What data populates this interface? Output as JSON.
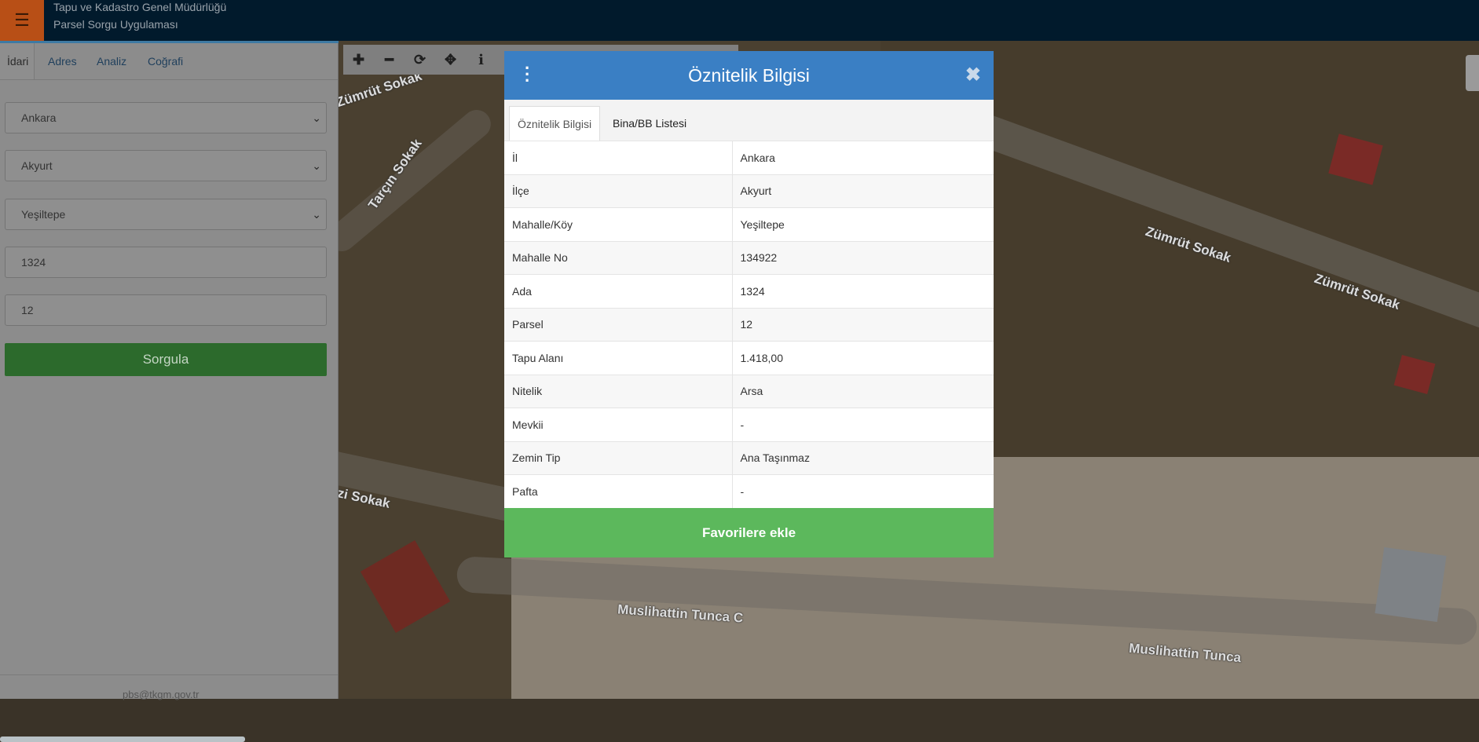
{
  "app": {
    "org_title": "Tapu ve Kadastro Genel Müdürlüğü",
    "app_title": "Parsel Sorgu Uygulaması",
    "menu_icon": "hamburger-icon"
  },
  "sidebar": {
    "tabs": [
      "İdari",
      "Adres",
      "Analiz",
      "Coğrafi"
    ],
    "active_tab": "İdari",
    "il": "Ankara",
    "ilce": "Akyurt",
    "mahalle": "Yeşiltepe",
    "ada": "1324",
    "parsel": "12",
    "query_button": "Sorgula",
    "footer_email": "pbs@tkgm.gov.tr"
  },
  "map": {
    "toolbar_icons": [
      "zoom-in-icon",
      "zoom-out-icon",
      "refresh-icon",
      "pan-icon",
      "info-icon"
    ],
    "road_labels": [
      "Zümrüt Sokak",
      "Tarçın Sokak",
      "Zümrüt Sokak",
      "Zümrüt Sokak",
      "zi Sokak",
      "Muslihattin Tunca C",
      "Muslihattin Tunca"
    ]
  },
  "modal": {
    "title": "Öznitelik Bilgisi",
    "tabs": [
      "Öznitelik Bilgisi",
      "Bina/BB Listesi"
    ],
    "rows": [
      {
        "key": "İl",
        "value": "Ankara"
      },
      {
        "key": "İlçe",
        "value": "Akyurt"
      },
      {
        "key": "Mahalle/Köy",
        "value": "Yeşiltepe"
      },
      {
        "key": "Mahalle No",
        "value": "134922"
      },
      {
        "key": "Ada",
        "value": "1324"
      },
      {
        "key": "Parsel",
        "value": "12"
      },
      {
        "key": "Tapu Alanı",
        "value": "1.418,00"
      },
      {
        "key": "Nitelik",
        "value": "Arsa"
      },
      {
        "key": "Mevkii",
        "value": "-"
      },
      {
        "key": "Zemin Tip",
        "value": "Ana Taşınmaz"
      },
      {
        "key": "Pafta",
        "value": "-"
      }
    ],
    "favorite_button": "Favorilere ekle"
  },
  "colors": {
    "header_blue": "#3a7fc4",
    "favorite_green": "#5cb85c",
    "query_green": "#2c6a2c",
    "menu_orange": "#b84f16"
  }
}
